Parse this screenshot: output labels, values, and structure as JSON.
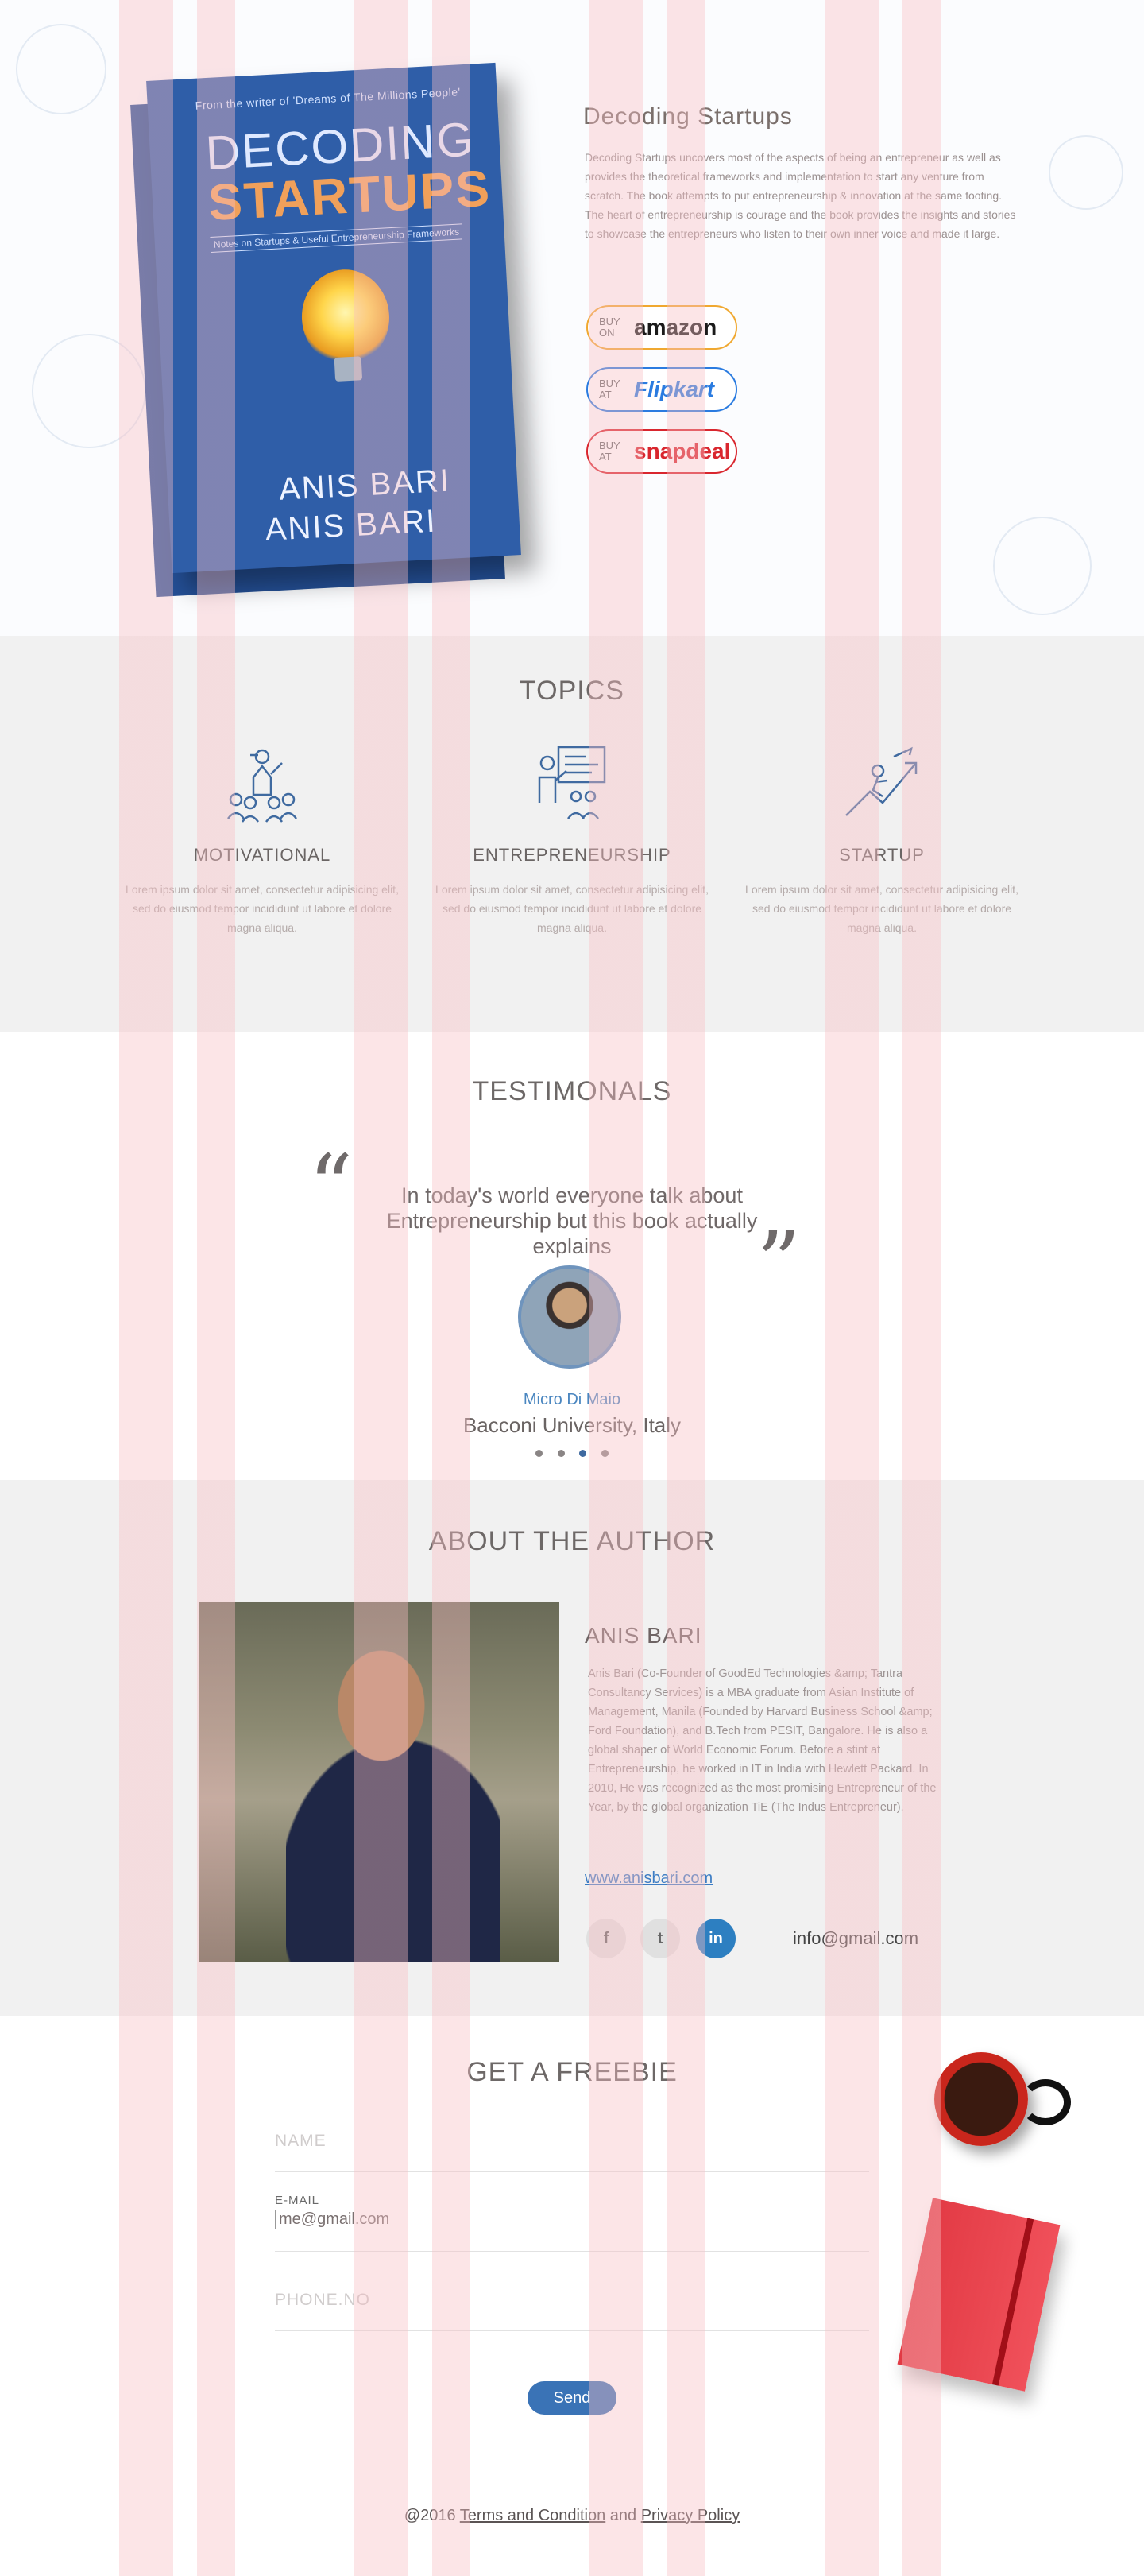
{
  "hero": {
    "book": {
      "top_line": "From the writer of 'Dreams of The Millions People'",
      "title_line1": "DECODING",
      "title_line2": "STARTUPS",
      "subtitle": "Notes on Startups & Useful Entrepreneurship Frameworks",
      "author": "ANIS BARI"
    },
    "title": "Decoding Startups",
    "description": "Decoding Startups uncovers most of the aspects of being an entrepreneur as well as provides the theoretical frameworks and implementation to start any venture from scratch. The book attempts to put entrepreneurship & innovation at the same footing. The heart of entrepreneurship is courage and the book provides the insights and stories to showcase the entrepreneurs who listen to their own inner voice and made it large.",
    "stores": [
      {
        "small": "BUY ON",
        "brand": "amazon",
        "color": "#1a1a1a"
      },
      {
        "small": "BUY AT",
        "brand": "Flipkart",
        "color": "#2a7be0"
      },
      {
        "small": "BUY AT",
        "brand": "snapdeal",
        "color": "#d9262e"
      }
    ]
  },
  "topics": {
    "title": "TOPICS",
    "items": [
      {
        "name": "MOTIVATIONAL",
        "text": "Lorem ipsum dolor sit amet, consectetur adipisicing elit, sed do eiusmod tempor incididunt ut labore et dolore magna aliqua."
      },
      {
        "name": "ENTREPRENEURSHIP",
        "text": "Lorem ipsum dolor sit amet, consectetur adipisicing elit, sed do eiusmod tempor incididunt ut labore et dolore magna aliqua."
      },
      {
        "name": "STARTUP",
        "text": "Lorem ipsum dolor sit amet, consectetur adipisicing elit, sed do eiusmod tempor incididunt ut labore et dolore magna aliqua."
      }
    ]
  },
  "testimonials": {
    "title": "TESTIMONALS",
    "quote": "In today's world everyone talk about Entrepreneurship but this book actually  explains",
    "name": "Micro Di Maio",
    "org": "Bacconi University, Italy",
    "slide_count": 4,
    "active_slide": 3
  },
  "about": {
    "title": "ABOUT THE AUTHOR",
    "name": "ANIS BARI",
    "bio": "Anis Bari (Co-Founder of GoodEd Technologies &amp; Tantra Consultancy Services) is a MBA graduate from Asian Institute of Management, Manila (Founded by Harvard Business School &amp; Ford Foundation), and B.Tech from PESIT, Bangalore. He is also a global shaper of World Economic Forum. Before a stint at Entrepreneurship, he worked in IT in India with Hewlett Packard. In 2010, He was recognized as the most promising Entrepreneur of the Year, by the global organization TiE (The Indus Entrepreneur).",
    "website": "www.anisbari.com",
    "social": [
      {
        "icon": "facebook-icon",
        "glyph": "f"
      },
      {
        "icon": "twitter-icon",
        "glyph": "t"
      },
      {
        "icon": "linkedin-icon",
        "glyph": "in"
      }
    ],
    "email": "info@gmail.com"
  },
  "freebie": {
    "title": "GET A FREEBIE",
    "name_placeholder": "NAME",
    "email_label": "E-MAIL",
    "email_value": "me@gmail.com",
    "phone_placeholder": "PHONE.NO",
    "send_label": "Send"
  },
  "footer": {
    "copyright": "@2016",
    "terms": "Terms and Condition",
    "and": "and",
    "privacy": "Privacy Policy"
  },
  "colors": {
    "accent_blue": "#3a73b6",
    "section_gray": "#f1f1f1",
    "stripe_pink": "#f8bec3"
  }
}
